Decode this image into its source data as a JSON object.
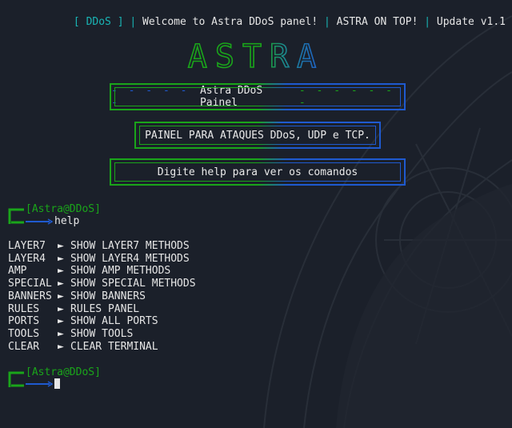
{
  "topbar": {
    "tag": "DDoS",
    "welcome": "Welcome to Astra DDoS panel!",
    "motto": "ASTRA ON TOP!",
    "version": "Update v1.1"
  },
  "logo": {
    "text": "ASTRA"
  },
  "boxes": {
    "title": "Astra DDoS Painel",
    "subtitle": "PAINEL PARA ATAQUES DDoS, UDP e TCP.",
    "hint": "Digite help para ver os comandos"
  },
  "prompt": {
    "user": "[Astra@DDoS]",
    "command": "help"
  },
  "menu": [
    {
      "key": "LAYER7",
      "desc": "SHOW LAYER7 METHODS"
    },
    {
      "key": "LAYER4",
      "desc": "SHOW LAYER4 METHODS"
    },
    {
      "key": "AMP",
      "desc": "SHOW AMP METHODS"
    },
    {
      "key": "SPECIAL",
      "desc": "SHOW SPECIAL METHODS"
    },
    {
      "key": "BANNERS",
      "desc": "SHOW BANNERS"
    },
    {
      "key": "RULES",
      "desc": "RULES PANEL"
    },
    {
      "key": "PORTS",
      "desc": "SHOW ALL PORTS"
    },
    {
      "key": "TOOLS",
      "desc": "SHOW TOOLS"
    },
    {
      "key": "CLEAR",
      "desc": "CLEAR TERMINAL"
    }
  ],
  "prompt2": {
    "user": "[Astra@DDoS]"
  },
  "colors": {
    "background": "#1b202a",
    "green": "#1aa51a",
    "blue": "#1f5ad0",
    "teal": "#19b5b5"
  }
}
